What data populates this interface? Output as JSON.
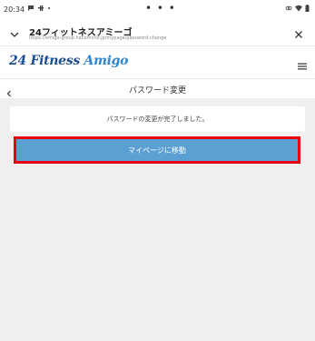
{
  "status_bar": {
    "time": "20:34",
    "dots": "• • •"
  },
  "browser": {
    "title": "24フィットネスアミーゴ",
    "url": "https://amigo-group.hacomono.jp/mypage/password-change"
  },
  "site": {
    "logo_num": "24",
    "logo_mid": "Fitness",
    "logo_tail": "Amigo"
  },
  "page": {
    "title": "パスワード変更",
    "message": "パスワードの変更が完了しました。",
    "button_label": "マイページに移動"
  },
  "colors": {
    "button_bg": "#5aa0d2",
    "button_highlight": "#e8000b",
    "logo_dark": "#1b4f92",
    "logo_light": "#2f86d2"
  },
  "icons": {
    "status_left": [
      "chat-bubble-icon",
      "slack-icon",
      "dot-icon"
    ],
    "status_right": [
      "link-icon",
      "wifi-icon",
      "battery-icon"
    ],
    "browser_left": "chevron-down-icon",
    "browser_right": "close-icon",
    "header_right": "hamburger-menu-icon",
    "page_left": "back-chevron-icon"
  }
}
